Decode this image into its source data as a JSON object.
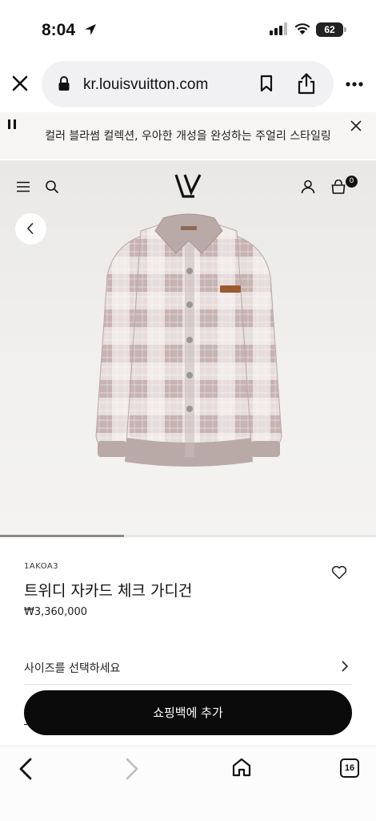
{
  "status_bar": {
    "time": "8:04",
    "battery": "62"
  },
  "browser": {
    "url": "kr.louisvuitton.com"
  },
  "announcement": {
    "text": "컬러 블라썸 컬렉션, 우아한 개성을 완성하는 주얼리 스타일링"
  },
  "header": {
    "bag_count": "0",
    "logo": "LV"
  },
  "gallery": {
    "progress": 0.33
  },
  "product": {
    "sku": "1AKOA3",
    "name": "트위디 자카드 체크 가디건",
    "price": "₩3,360,000"
  },
  "size_selector": {
    "label": "사이즈를 선택하세요"
  },
  "cta": {
    "add_to_bag": "쇼핑백에 추가"
  },
  "toolbar": {
    "tab_count": "16"
  },
  "icons": [
    "location-arrow-icon",
    "signal-icon",
    "wifi-icon",
    "close-icon",
    "lock-icon",
    "bookmark-icon",
    "share-icon",
    "more-icon",
    "pause-icon",
    "menu-icon",
    "search-icon",
    "account-icon",
    "bag-icon",
    "back-icon",
    "heart-icon",
    "chevron-right-icon",
    "home-icon",
    "tabs-icon"
  ]
}
